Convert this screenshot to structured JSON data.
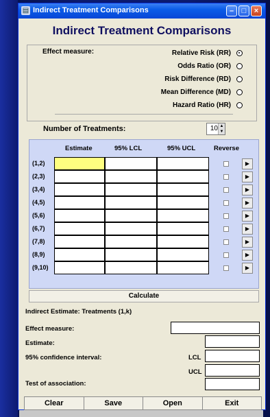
{
  "window": {
    "title": "Indirect Treatment Comparisons"
  },
  "app": {
    "heading": "Indirect Treatment Comparisons"
  },
  "effect_measure": {
    "label": "Effect measure:",
    "options": [
      {
        "label": "Relative Risk (RR)",
        "selected": true
      },
      {
        "label": "Odds Ratio (OR)",
        "selected": false
      },
      {
        "label": "Risk Difference (RD)",
        "selected": false
      },
      {
        "label": "Mean Difference (MD)",
        "selected": false
      },
      {
        "label": "Hazard Ratio (HR)",
        "selected": false
      }
    ]
  },
  "treatments": {
    "label": "Number of Treatments:",
    "value": "10"
  },
  "grid": {
    "headers": {
      "estimate": "Estimate",
      "lcl": "95% LCL",
      "ucl": "95% UCL",
      "reverse": "Reverse"
    },
    "rows": [
      "(1,2)",
      "(2,3)",
      "(3,4)",
      "(4,5)",
      "(5,6)",
      "(6,7)",
      "(7,8)",
      "(8,9)",
      "(9,10)"
    ]
  },
  "calculate_label": "Calculate",
  "results": {
    "heading": "Indirect Estimate: Treatments (1,k)",
    "effect_measure": "Effect measure:",
    "estimate": "Estimate:",
    "ci": "95% confidence interval:",
    "lcl": "LCL",
    "ucl": "UCL",
    "test": "Test of association:"
  },
  "buttons": {
    "clear": "Clear",
    "save": "Save",
    "open": "Open",
    "exit": "Exit"
  },
  "colors": {
    "title_bar": "#0a5ce8",
    "grid_bg": "#cfd8f6",
    "active_cell": "#ffff80"
  }
}
